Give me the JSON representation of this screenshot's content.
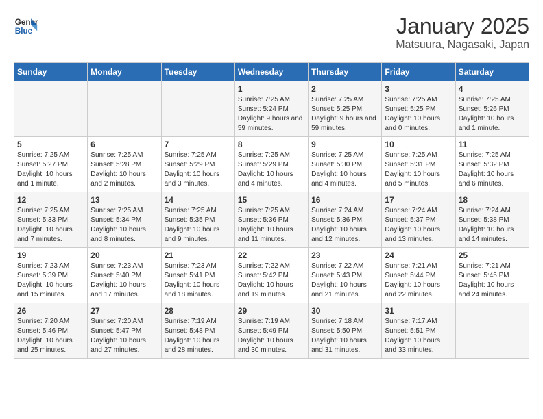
{
  "header": {
    "logo_line1": "General",
    "logo_line2": "Blue",
    "title": "January 2025",
    "subtitle": "Matsuura, Nagasaki, Japan"
  },
  "days_of_week": [
    "Sunday",
    "Monday",
    "Tuesday",
    "Wednesday",
    "Thursday",
    "Friday",
    "Saturday"
  ],
  "weeks": [
    [
      {
        "day": "",
        "info": ""
      },
      {
        "day": "",
        "info": ""
      },
      {
        "day": "",
        "info": ""
      },
      {
        "day": "1",
        "info": "Sunrise: 7:25 AM\nSunset: 5:24 PM\nDaylight: 9 hours and 59 minutes."
      },
      {
        "day": "2",
        "info": "Sunrise: 7:25 AM\nSunset: 5:25 PM\nDaylight: 9 hours and 59 minutes."
      },
      {
        "day": "3",
        "info": "Sunrise: 7:25 AM\nSunset: 5:25 PM\nDaylight: 10 hours and 0 minutes."
      },
      {
        "day": "4",
        "info": "Sunrise: 7:25 AM\nSunset: 5:26 PM\nDaylight: 10 hours and 1 minute."
      }
    ],
    [
      {
        "day": "5",
        "info": "Sunrise: 7:25 AM\nSunset: 5:27 PM\nDaylight: 10 hours and 1 minute."
      },
      {
        "day": "6",
        "info": "Sunrise: 7:25 AM\nSunset: 5:28 PM\nDaylight: 10 hours and 2 minutes."
      },
      {
        "day": "7",
        "info": "Sunrise: 7:25 AM\nSunset: 5:29 PM\nDaylight: 10 hours and 3 minutes."
      },
      {
        "day": "8",
        "info": "Sunrise: 7:25 AM\nSunset: 5:29 PM\nDaylight: 10 hours and 4 minutes."
      },
      {
        "day": "9",
        "info": "Sunrise: 7:25 AM\nSunset: 5:30 PM\nDaylight: 10 hours and 4 minutes."
      },
      {
        "day": "10",
        "info": "Sunrise: 7:25 AM\nSunset: 5:31 PM\nDaylight: 10 hours and 5 minutes."
      },
      {
        "day": "11",
        "info": "Sunrise: 7:25 AM\nSunset: 5:32 PM\nDaylight: 10 hours and 6 minutes."
      }
    ],
    [
      {
        "day": "12",
        "info": "Sunrise: 7:25 AM\nSunset: 5:33 PM\nDaylight: 10 hours and 7 minutes."
      },
      {
        "day": "13",
        "info": "Sunrise: 7:25 AM\nSunset: 5:34 PM\nDaylight: 10 hours and 8 minutes."
      },
      {
        "day": "14",
        "info": "Sunrise: 7:25 AM\nSunset: 5:35 PM\nDaylight: 10 hours and 9 minutes."
      },
      {
        "day": "15",
        "info": "Sunrise: 7:25 AM\nSunset: 5:36 PM\nDaylight: 10 hours and 11 minutes."
      },
      {
        "day": "16",
        "info": "Sunrise: 7:24 AM\nSunset: 5:36 PM\nDaylight: 10 hours and 12 minutes."
      },
      {
        "day": "17",
        "info": "Sunrise: 7:24 AM\nSunset: 5:37 PM\nDaylight: 10 hours and 13 minutes."
      },
      {
        "day": "18",
        "info": "Sunrise: 7:24 AM\nSunset: 5:38 PM\nDaylight: 10 hours and 14 minutes."
      }
    ],
    [
      {
        "day": "19",
        "info": "Sunrise: 7:23 AM\nSunset: 5:39 PM\nDaylight: 10 hours and 15 minutes."
      },
      {
        "day": "20",
        "info": "Sunrise: 7:23 AM\nSunset: 5:40 PM\nDaylight: 10 hours and 17 minutes."
      },
      {
        "day": "21",
        "info": "Sunrise: 7:23 AM\nSunset: 5:41 PM\nDaylight: 10 hours and 18 minutes."
      },
      {
        "day": "22",
        "info": "Sunrise: 7:22 AM\nSunset: 5:42 PM\nDaylight: 10 hours and 19 minutes."
      },
      {
        "day": "23",
        "info": "Sunrise: 7:22 AM\nSunset: 5:43 PM\nDaylight: 10 hours and 21 minutes."
      },
      {
        "day": "24",
        "info": "Sunrise: 7:21 AM\nSunset: 5:44 PM\nDaylight: 10 hours and 22 minutes."
      },
      {
        "day": "25",
        "info": "Sunrise: 7:21 AM\nSunset: 5:45 PM\nDaylight: 10 hours and 24 minutes."
      }
    ],
    [
      {
        "day": "26",
        "info": "Sunrise: 7:20 AM\nSunset: 5:46 PM\nDaylight: 10 hours and 25 minutes."
      },
      {
        "day": "27",
        "info": "Sunrise: 7:20 AM\nSunset: 5:47 PM\nDaylight: 10 hours and 27 minutes."
      },
      {
        "day": "28",
        "info": "Sunrise: 7:19 AM\nSunset: 5:48 PM\nDaylight: 10 hours and 28 minutes."
      },
      {
        "day": "29",
        "info": "Sunrise: 7:19 AM\nSunset: 5:49 PM\nDaylight: 10 hours and 30 minutes."
      },
      {
        "day": "30",
        "info": "Sunrise: 7:18 AM\nSunset: 5:50 PM\nDaylight: 10 hours and 31 minutes."
      },
      {
        "day": "31",
        "info": "Sunrise: 7:17 AM\nSunset: 5:51 PM\nDaylight: 10 hours and 33 minutes."
      },
      {
        "day": "",
        "info": ""
      }
    ]
  ]
}
